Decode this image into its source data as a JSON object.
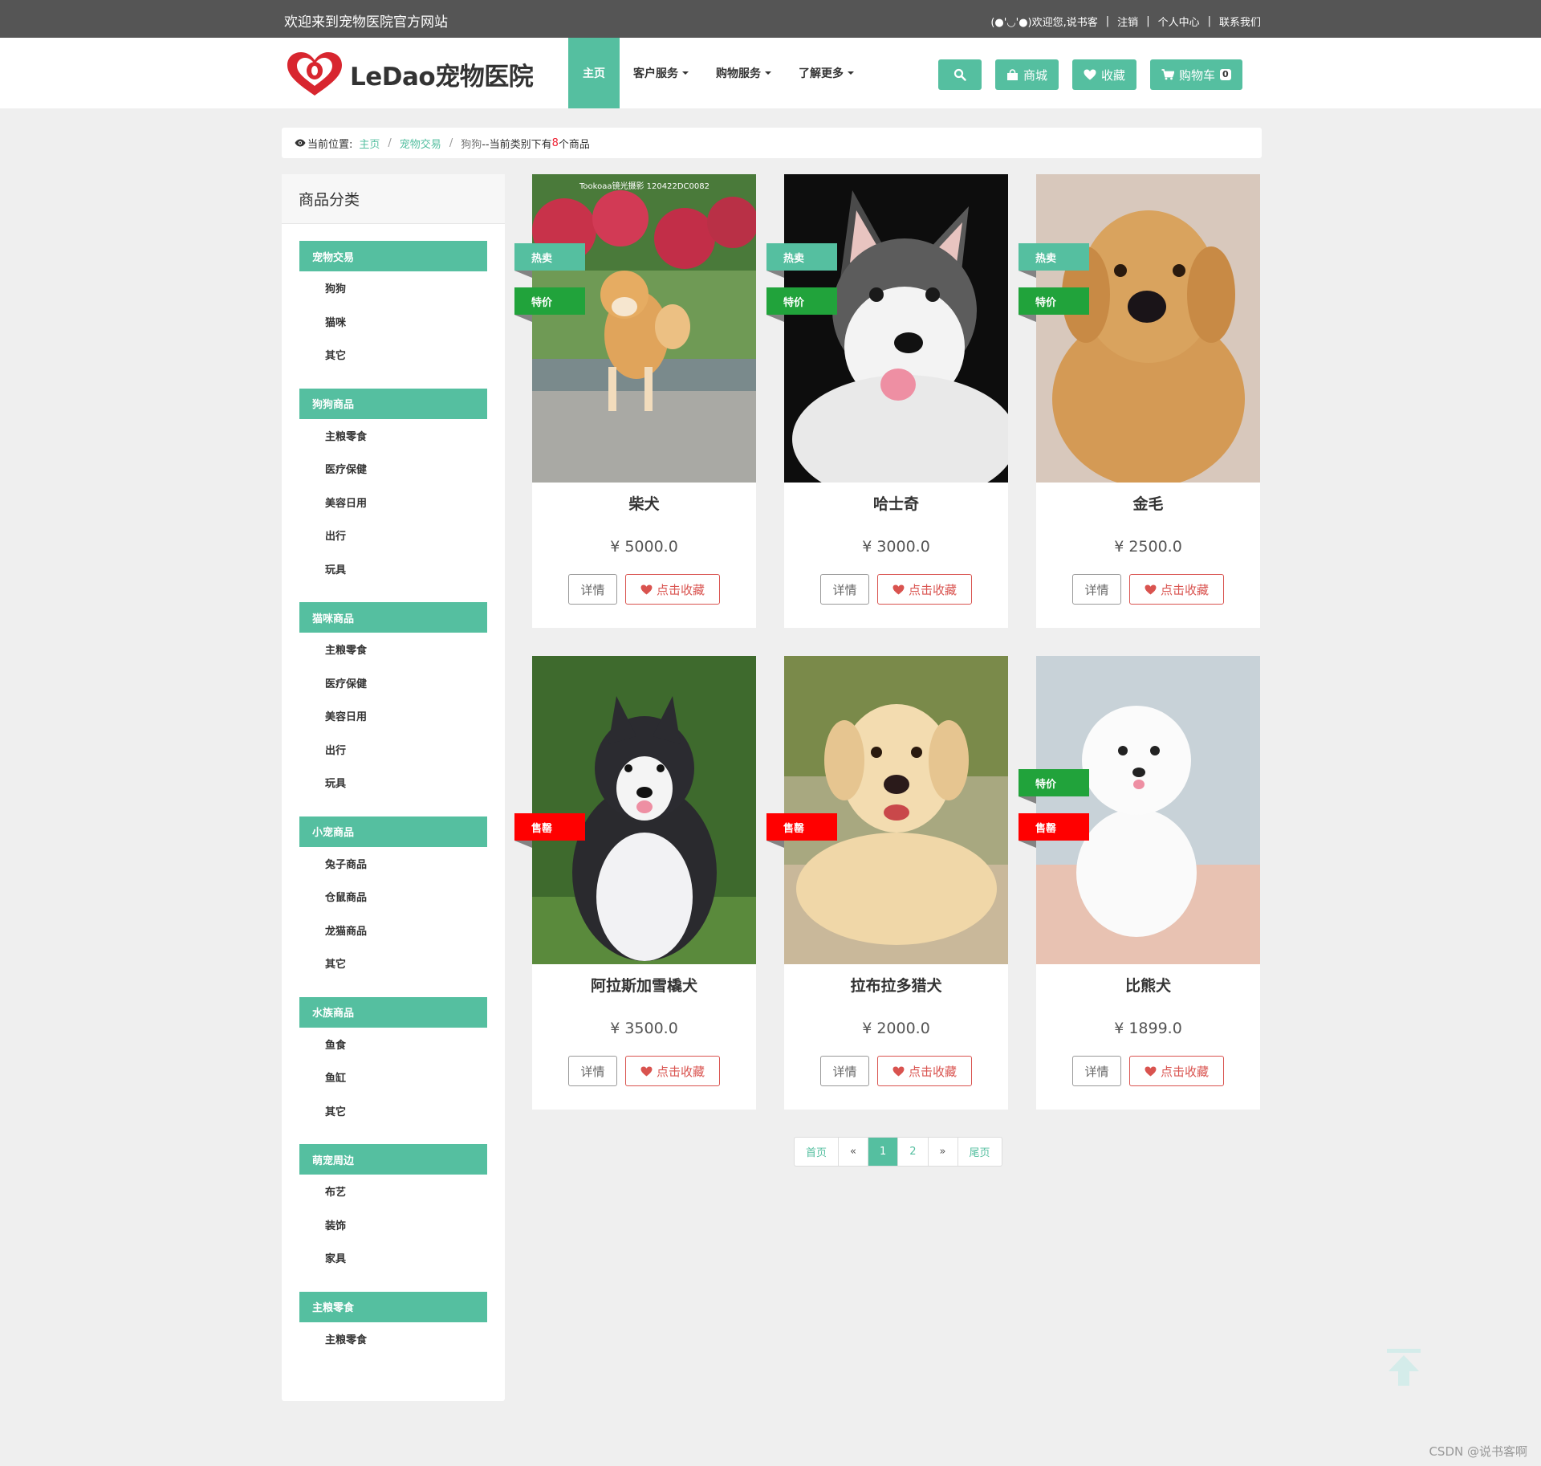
{
  "topbar": {
    "welcome": "欢迎来到宠物医院官方网站",
    "user_greeting": "(●'◡'●)欢迎您,说书客",
    "logout": "注销",
    "profile": "个人中心",
    "contact": "联系我们",
    "separator": "|"
  },
  "logo": {
    "text": "LeDao宠物医院"
  },
  "nav": {
    "items": [
      {
        "label": "主页",
        "active": true
      },
      {
        "label": "客户服务",
        "dropdown": true
      },
      {
        "label": "购物服务",
        "dropdown": true
      },
      {
        "label": "了解更多",
        "dropdown": true
      }
    ],
    "buttons": {
      "shop": "商城",
      "favorites": "收藏",
      "cart": "购物车",
      "cart_count": "0"
    }
  },
  "breadcrumb": {
    "prefix": "当前位置:",
    "home": "主页",
    "category": "宠物交易",
    "current": "狗狗",
    "summary_pre": "--当前类别下有",
    "count": "8",
    "summary_post": "个商品"
  },
  "sidebar": {
    "title": "商品分类",
    "groups": [
      {
        "title": "宠物交易",
        "items": [
          "狗狗",
          "猫咪",
          "其它"
        ]
      },
      {
        "title": "狗狗商品",
        "items": [
          "主粮零食",
          "医疗保健",
          "美容日用",
          "出行",
          "玩具"
        ]
      },
      {
        "title": "猫咪商品",
        "items": [
          "主粮零食",
          "医疗保健",
          "美容日用",
          "出行",
          "玩具"
        ]
      },
      {
        "title": "小宠商品",
        "items": [
          "兔子商品",
          "仓鼠商品",
          "龙猫商品",
          "其它"
        ]
      },
      {
        "title": "水族商品",
        "items": [
          "鱼食",
          "鱼缸",
          "其它"
        ]
      },
      {
        "title": "萌宠周边",
        "items": [
          "布艺",
          "装饰",
          "家具"
        ]
      },
      {
        "title": "主粮零食",
        "items": [
          "主粮零食"
        ]
      }
    ]
  },
  "products": [
    {
      "name": "柴犬",
      "price": "¥ 5000.0",
      "detail": "详情",
      "fav": "点击收藏",
      "photo_text": "Tookoaa镜光摄影 120422DC0082"
    },
    {
      "name": "哈士奇",
      "price": "¥ 3000.0",
      "detail": "详情",
      "fav": "点击收藏"
    },
    {
      "name": "金毛",
      "price": "¥ 2500.0",
      "detail": "详情",
      "fav": "点击收藏"
    },
    {
      "name": "阿拉斯加雪橇犬",
      "price": "¥ 3500.0",
      "detail": "详情",
      "fav": "点击收藏"
    },
    {
      "name": "拉布拉多猎犬",
      "price": "¥ 2000.0",
      "detail": "详情",
      "fav": "点击收藏"
    },
    {
      "name": "比熊犬",
      "price": "¥ 1899.0",
      "detail": "详情",
      "fav": "点击收藏"
    }
  ],
  "ribbons": {
    "hot": "热卖",
    "special": "特价",
    "soldout": "售罄"
  },
  "pagination": {
    "first": "首页",
    "prev": "«",
    "pages": [
      "1",
      "2"
    ],
    "next": "»",
    "last": "尾页",
    "current": "1"
  },
  "watermark": "CSDN @说书客啊",
  "colors": {
    "accent": "#55bfa0",
    "topbar": "#555555",
    "special_ribbon": "#21a33b",
    "soldout_ribbon": "#ff0000",
    "favorite": "#d9534f"
  }
}
